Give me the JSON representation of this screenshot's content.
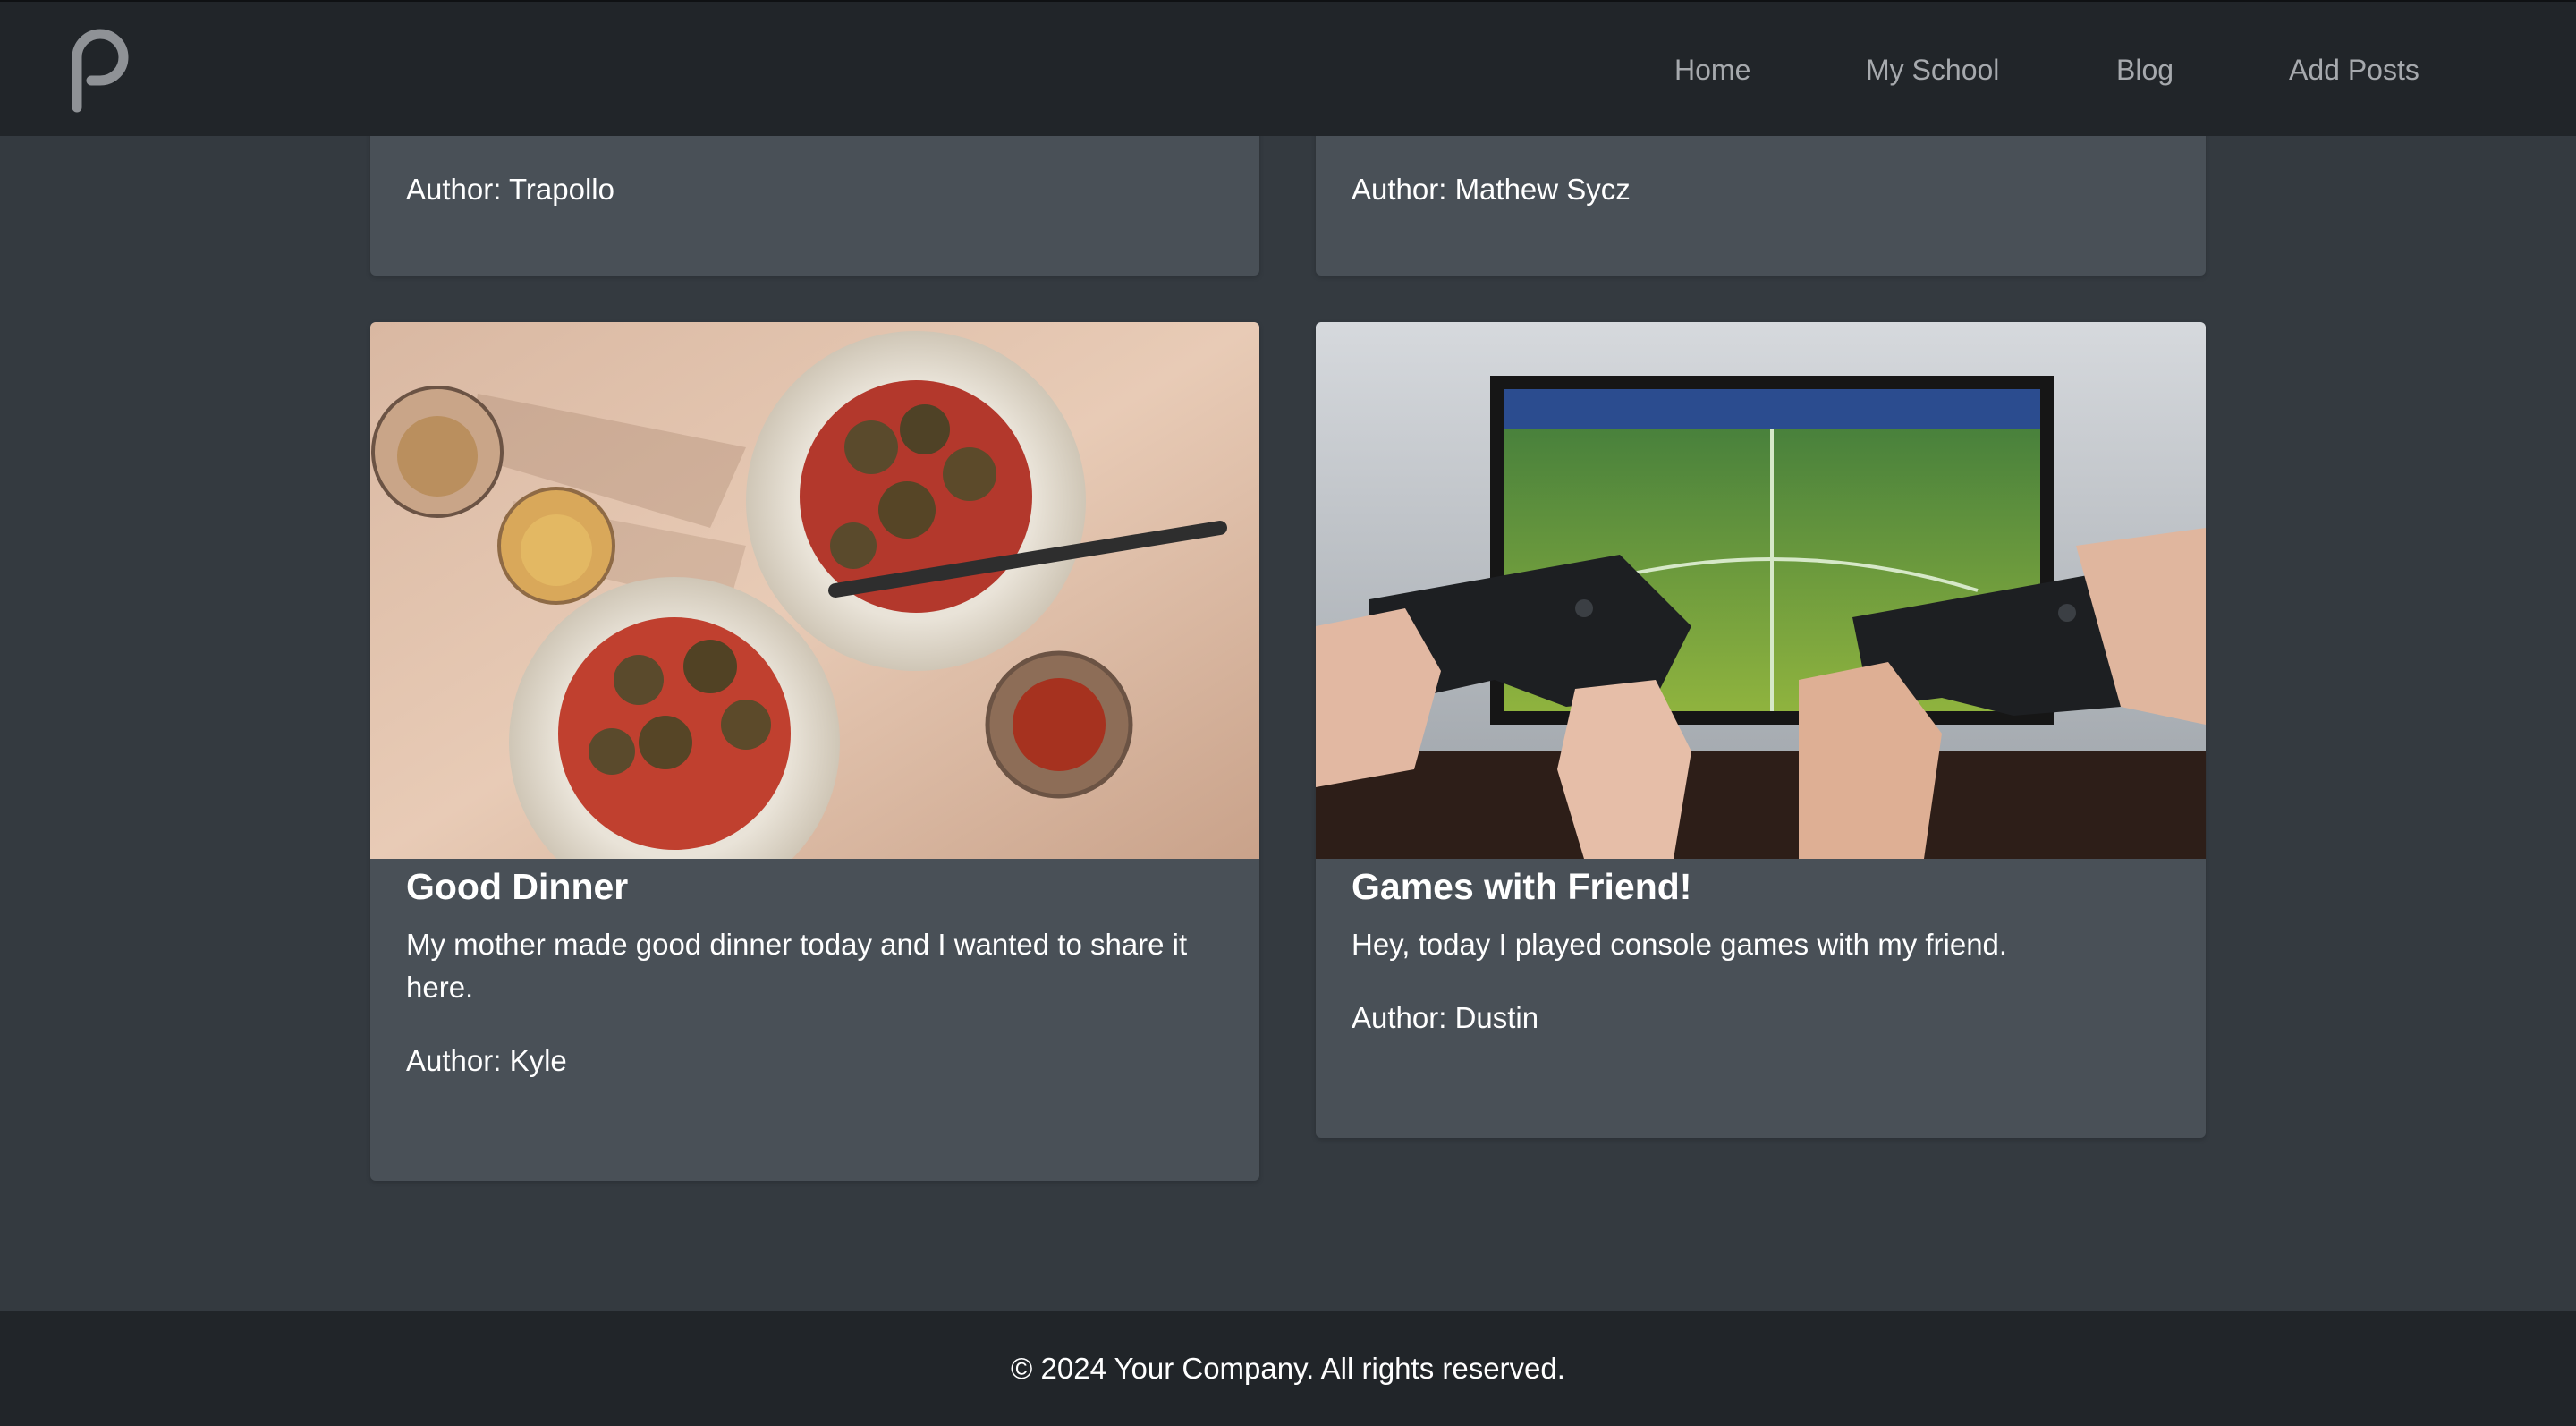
{
  "nav": {
    "logo_letter": "p",
    "links": [
      "Home",
      "My School",
      "Blog",
      "Add Posts"
    ]
  },
  "top_cards": [
    {
      "author": "Author: Trapollo"
    },
    {
      "author": "Author: Mathew Sycz"
    }
  ],
  "cards": [
    {
      "image": "food-photo",
      "title": "Good Dinner",
      "text": "My mother made good dinner today and I wanted to share it here.",
      "author": "Author: Kyle"
    },
    {
      "image": "gaming-photo",
      "title": "Games with Friend!",
      "text": "Hey, today I played console games with my friend.",
      "author": "Author: Dustin"
    }
  ],
  "footer": {
    "text": "© 2024 Your Company. All rights reserved."
  },
  "colors": {
    "navbar": "#212529",
    "page": "#343a40",
    "card": "#495057",
    "nav_link": "#a6a9ad"
  }
}
